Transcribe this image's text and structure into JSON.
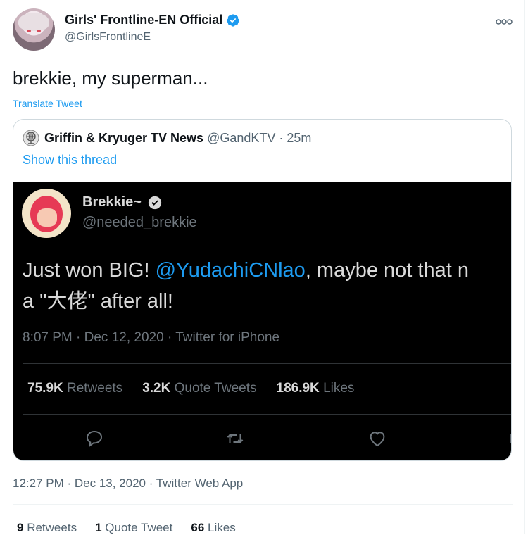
{
  "tweet": {
    "display_name": "Girls' Frontline-EN Official",
    "handle": "@GirlsFrontlineE",
    "text": "brekkie, my superman...",
    "translate_label": "Translate Tweet",
    "timestamp": "12:27 PM · Dec 13, 2020 · Twitter Web App",
    "stats": {
      "retweets_count": "9",
      "retweets_label": "Retweets",
      "quotes_count": "1",
      "quotes_label": "Quote Tweet",
      "likes_count": "66",
      "likes_label": "Likes"
    }
  },
  "quote": {
    "display_name": "Griffin & Kryuger TV News",
    "meta": "@GandKTV · 25m",
    "thread_link": "Show this thread"
  },
  "embedded": {
    "display_name": "Brekkie~",
    "handle": "@needed_brekkie",
    "text_start": "Just won BIG! ",
    "mention": "@YudachiCNlao",
    "text_end": ", maybe not that n",
    "text_line2": "a \"大佬\" after all!",
    "date": "8:07 PM · Dec 12, 2020 · Twitter for iPhone",
    "stats": {
      "retweets_count": "75.9K",
      "retweets_label": "Retweets",
      "quotes_count": "3.2K",
      "quotes_label": "Quote Tweets",
      "likes_count": "186.9K",
      "likes_label": "Likes"
    }
  },
  "colors": {
    "accent": "#1d9bf0",
    "text": "#0f1419",
    "muted": "#536471",
    "dark_bg": "#000000"
  },
  "icons": [
    "verified-badge-icon",
    "more-options-icon",
    "globe-icon",
    "reply-icon",
    "retweet-icon",
    "like-icon"
  ]
}
